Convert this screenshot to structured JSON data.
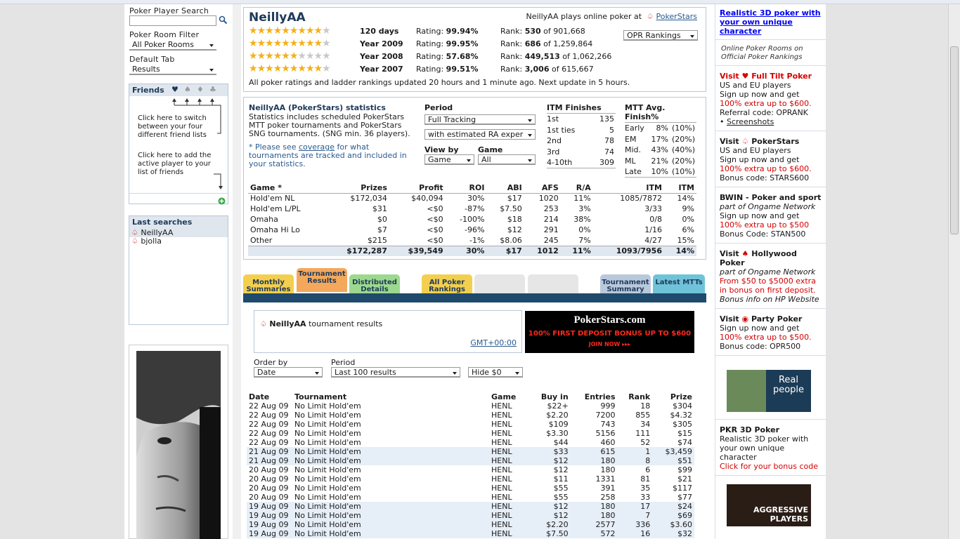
{
  "left": {
    "search_label": "Poker Player Search",
    "room_filter_label": "Poker Room Filter",
    "room_filter_value": "All Poker Rooms",
    "default_tab_label": "Default Tab",
    "default_tab_value": "Results",
    "friends": {
      "title": "Friends",
      "hint1": "Click here to switch between your four different friend lists",
      "hint2": "Click here to add the active player to your list of friends"
    },
    "last_searches": {
      "title": "Last searches",
      "items": [
        "NeillyAA",
        "bjolla"
      ]
    }
  },
  "player": {
    "name": "NeillyAA",
    "plays_text": "NeillyAA plays online poker at",
    "room": "PokerStars",
    "ranking_select": "OPR Rankings",
    "ratings": [
      {
        "period": "120 days",
        "stars": 9,
        "rating_label": "Rating:",
        "rating": "99.94%",
        "rank_label": "Rank:",
        "rank": "530",
        "of": "of 901,668"
      },
      {
        "period": "Year 2009",
        "stars": 9,
        "rating_label": "Rating:",
        "rating": "99.95%",
        "rank_label": "Rank:",
        "rank": "686",
        "of": "of 1,259,864"
      },
      {
        "period": "Year 2008",
        "stars": 6,
        "rating_label": "Rating:",
        "rating": "57.68%",
        "rank_label": "Rank:",
        "rank": "449,513",
        "of": "of 1,062,266"
      },
      {
        "period": "Year 2007",
        "stars": 9,
        "rating_label": "Rating:",
        "rating": "99.51%",
        "rank_label": "Rank:",
        "rank": "3,006",
        "of": "of 615,667"
      }
    ],
    "update_note": "All poker ratings and ladder rankings updated 20 hours and 1 minute ago. Next update in 5 hours."
  },
  "stats": {
    "title": "NeillyAA (PokerStars) statistics",
    "desc": "Statistics includes scheduled PokerStars MTT poker tournaments and PokerStars SNG tournaments. (SNG min. 36 players).",
    "note_pre": "* Please see ",
    "note_link": "coverage",
    "note_post": " for what tournaments are tracked and included in your statistics.",
    "period_label": "Period",
    "period_value": "Full Tracking",
    "ra_value": "with estimated RA exper",
    "viewby_label": "View by",
    "viewby_value": "Game",
    "game_label": "Game",
    "game_value": "All",
    "itm": {
      "title": "ITM Finishes",
      "rows": [
        [
          "1st",
          "135"
        ],
        [
          "1st ties",
          "5"
        ],
        [
          "2nd",
          "78"
        ],
        [
          "3rd",
          "74"
        ],
        [
          "4-10th",
          "309"
        ]
      ]
    },
    "mtt": {
      "title": "MTT Avg. Finish%",
      "rows": [
        [
          "Early",
          "8%",
          "(10%)"
        ],
        [
          "EM",
          "17%",
          "(20%)"
        ],
        [
          "Mid.",
          "43%",
          "(40%)"
        ],
        [
          "ML",
          "21%",
          "(20%)"
        ],
        [
          "Late",
          "10%",
          "(10%)"
        ]
      ]
    },
    "headers": [
      "Game *",
      "Prizes",
      "Profit",
      "ROI",
      "ABI",
      "AFS",
      "R/A",
      "ITM",
      "ITM"
    ],
    "rows": [
      [
        "Hold'em NL",
        "$172,034",
        "$40,094",
        "30%",
        "$17",
        "1020",
        "11%",
        "1085/7872",
        "14%"
      ],
      [
        "Hold'em L/PL",
        "$31",
        "<$0",
        "-87%",
        "$7.50",
        "253",
        "3%",
        "3/33",
        "9%"
      ],
      [
        "Omaha",
        "$0",
        "<$0",
        "-100%",
        "$18",
        "214",
        "38%",
        "0/8",
        "0%"
      ],
      [
        "Omaha Hi Lo",
        "$7",
        "<$0",
        "-96%",
        "$12",
        "291",
        "0%",
        "1/16",
        "6%"
      ],
      [
        "Other",
        "$215",
        "<$0",
        "-1%",
        "$8.06",
        "245",
        "7%",
        "4/27",
        "15%"
      ]
    ],
    "total": [
      "",
      "$172,287",
      "$39,549",
      "30%",
      "$17",
      "1012",
      "11%",
      "1093/7956",
      "14%"
    ]
  },
  "tabs": [
    {
      "label": "Monthly Summaries",
      "color": "#f3cf4f"
    },
    {
      "label": "Tournament Results",
      "color": "#f4a85c"
    },
    {
      "label": "Distributed Details",
      "color": "#9cd98e"
    },
    {
      "label": "All Poker Rankings",
      "color": "#f3cf4f"
    },
    {
      "label": "",
      "color": "#e6e6e6"
    },
    {
      "label": "",
      "color": "#e6e6e6"
    },
    {
      "label": "Tournament Summary",
      "color": "#b9c9dc"
    },
    {
      "label": "Latest MTTs",
      "color": "#6fc3d8"
    }
  ],
  "results": {
    "title_player": "NeillyAA",
    "title_rest": "tournament results",
    "tz": "GMT+00:00",
    "order_label": "Order by",
    "order_value": "Date",
    "period_label": "Period",
    "period_value": "Last 100 results",
    "hide_value": "Hide $0",
    "banner": {
      "brand": "PokerStars.com",
      "line": "100% FIRST DEPOSIT BONUS UP TO $600",
      "cta": "JOIN NOW ▸▸▸"
    },
    "headers": [
      "Date",
      "Tournament",
      "Game",
      "Buy in",
      "Entries",
      "Rank",
      "Prize"
    ],
    "rows": [
      [
        "22 Aug 09",
        "No Limit Hold'em",
        "HENL",
        "$22+",
        "999",
        "18",
        "$304",
        0
      ],
      [
        "22 Aug 09",
        "No Limit Hold'em",
        "HENL",
        "$2.20",
        "7200",
        "855",
        "$4.32",
        0
      ],
      [
        "22 Aug 09",
        "No Limit Hold'em",
        "HENL",
        "$109",
        "743",
        "34",
        "$305",
        0
      ],
      [
        "22 Aug 09",
        "No Limit Hold'em",
        "HENL",
        "$3.30",
        "5156",
        "111",
        "$15",
        0
      ],
      [
        "22 Aug 09",
        "No Limit Hold'em",
        "HENL",
        "$44",
        "460",
        "52",
        "$74",
        0
      ],
      [
        "21 Aug 09",
        "No Limit Hold'em",
        "HENL",
        "$33",
        "615",
        "1",
        "$3,459",
        1
      ],
      [
        "21 Aug 09",
        "No Limit Hold'em",
        "HENL",
        "$12",
        "180",
        "8",
        "$51",
        1
      ],
      [
        "20 Aug 09",
        "No Limit Hold'em",
        "HENL",
        "$12",
        "180",
        "6",
        "$99",
        0
      ],
      [
        "20 Aug 09",
        "No Limit Hold'em",
        "HENL",
        "$11",
        "1331",
        "81",
        "$21",
        0
      ],
      [
        "20 Aug 09",
        "No Limit Hold'em",
        "HENL",
        "$55",
        "391",
        "35",
        "$117",
        0
      ],
      [
        "20 Aug 09",
        "No Limit Hold'em",
        "HENL",
        "$55",
        "258",
        "33",
        "$77",
        0
      ],
      [
        "19 Aug 09",
        "No Limit Hold'em",
        "HENL",
        "$12",
        "180",
        "17",
        "$24",
        1
      ],
      [
        "19 Aug 09",
        "No Limit Hold'em",
        "HENL",
        "$12",
        "180",
        "7",
        "$69",
        1
      ],
      [
        "19 Aug 09",
        "No Limit Hold'em",
        "HENL",
        "$2.20",
        "2577",
        "336",
        "$3.60",
        1
      ],
      [
        "19 Aug 09",
        "No Limit Hold'em",
        "HENL",
        "$7.50",
        "572",
        "16",
        "$32",
        1
      ]
    ]
  },
  "right": {
    "top_link": "Realistic 3D poker with your own unique character",
    "opr_note": "Online Poker Rooms on Official Poker Rankings",
    "ads": [
      {
        "visit": "Visit",
        "room": "Full Tilt Poker",
        "l1": "US and EU players",
        "l2": "Sign up now and get",
        "l3": "100% extra up to $600.",
        "l4": "Referral code: OPRANK",
        "l5": "Screenshots",
        "red_title": true
      },
      {
        "visit": "Visit",
        "room": "PokerStars",
        "l1": "US and EU players",
        "l2": "Sign up now and get",
        "l3": "100% extra up to $600.",
        "l4": "Bonus code: STARS600"
      },
      {
        "visit": "",
        "room": "BWIN - Poker and sport",
        "l1": "part of  Ongame Network",
        "l2": "Sign up now and get",
        "l3": "100% extra up to $500",
        "l4": "Bonus Code: STAN500"
      },
      {
        "visit": "Visit",
        "room": "Hollywood Poker",
        "l1": "part of  Ongame Network",
        "l2": "From $50 to $5000 extra in bonus on first deposit.",
        "l4": "Bonus info on HP Website"
      },
      {
        "visit": "Visit",
        "room": "Party Poker",
        "l1": "Sign up now and get",
        "l3": "100% extra up to $500.",
        "l4": "Bonus code: OPR500"
      }
    ],
    "real_people": "Real people",
    "pkr_title": "PKR 3D Poker",
    "pkr_desc": "Realistic 3D poker with your own unique character",
    "pkr_cta": "Click for your bonus code",
    "aggressive": "AGGRESSIVE PLAYERS"
  }
}
